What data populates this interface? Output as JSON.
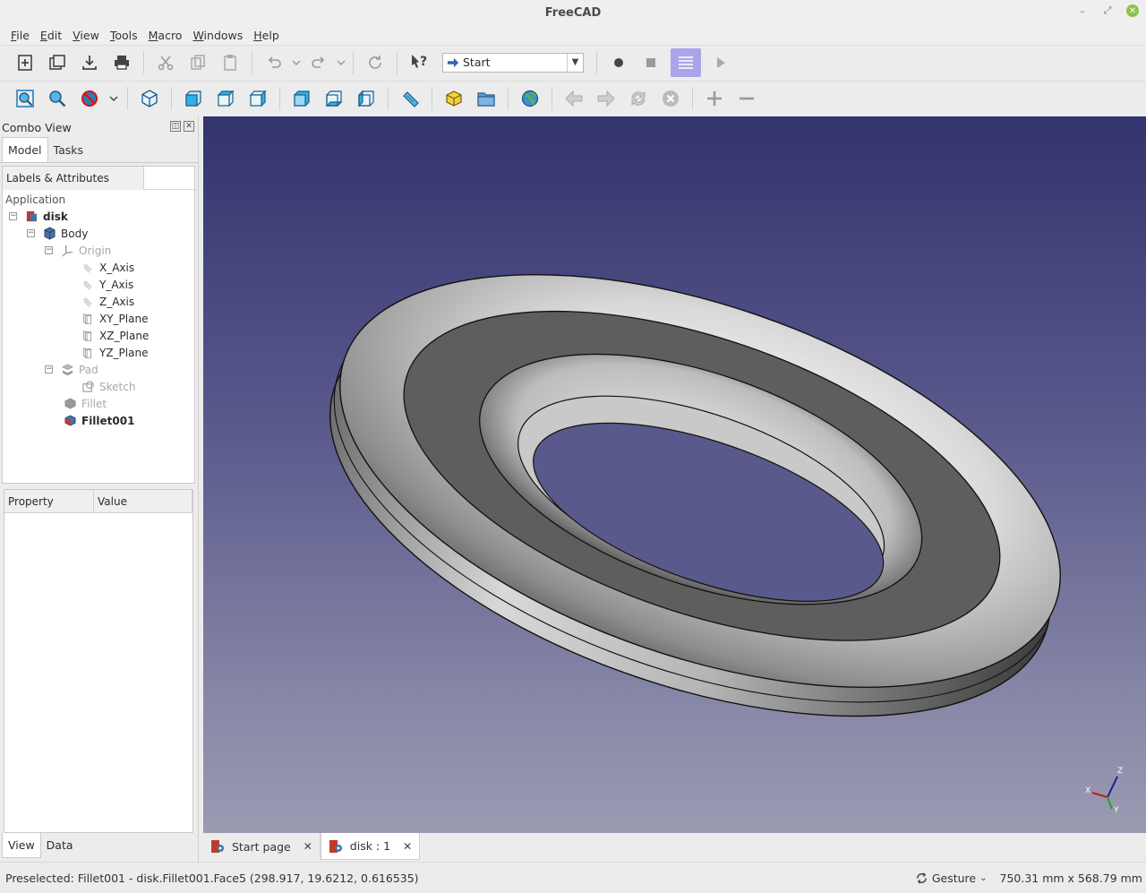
{
  "window": {
    "title": "FreeCAD"
  },
  "menu": [
    "File",
    "Edit",
    "View",
    "Tools",
    "Macro",
    "Windows",
    "Help"
  ],
  "toolbar": {
    "workbench": "Start"
  },
  "combo_view": {
    "title": "Combo View",
    "tabs": [
      "Model",
      "Tasks"
    ],
    "tree_header": "Labels & Attributes",
    "application_label": "Application",
    "tree": [
      {
        "label": "disk",
        "depth": 0,
        "style": "bold",
        "icon": "document-icon",
        "expander": "−"
      },
      {
        "label": "Body",
        "depth": 1,
        "style": "normal",
        "icon": "body-icon",
        "expander": "−"
      },
      {
        "label": "Origin",
        "depth": 2,
        "style": "grey",
        "icon": "origin-icon",
        "expander": "−"
      },
      {
        "label": "X_Axis",
        "depth": 3,
        "style": "normal",
        "icon": "axis-icon",
        "expander": ""
      },
      {
        "label": "Y_Axis",
        "depth": 3,
        "style": "normal",
        "icon": "axis-icon",
        "expander": ""
      },
      {
        "label": "Z_Axis",
        "depth": 3,
        "style": "normal",
        "icon": "axis-icon",
        "expander": ""
      },
      {
        "label": "XY_Plane",
        "depth": 3,
        "style": "normal",
        "icon": "plane-icon",
        "expander": ""
      },
      {
        "label": "XZ_Plane",
        "depth": 3,
        "style": "normal",
        "icon": "plane-icon",
        "expander": ""
      },
      {
        "label": "YZ_Plane",
        "depth": 3,
        "style": "normal",
        "icon": "plane-icon",
        "expander": ""
      },
      {
        "label": "Pad",
        "depth": 2,
        "style": "grey",
        "icon": "pad-icon",
        "expander": "−"
      },
      {
        "label": "Sketch",
        "depth": 3,
        "style": "grey",
        "icon": "sketch-icon",
        "expander": ""
      },
      {
        "label": "Fillet",
        "depth": 2,
        "style": "grey",
        "icon": "fillet-icon",
        "expander": ""
      },
      {
        "label": "Fillet001",
        "depth": 2,
        "style": "bold",
        "icon": "fillet-active-icon",
        "expander": ""
      }
    ],
    "property_headers": [
      "Property",
      "Value"
    ],
    "bottom_tabs": [
      "View",
      "Data"
    ]
  },
  "doc_tabs": [
    {
      "label": "Start page",
      "active": false
    },
    {
      "label": "disk : 1",
      "active": true
    }
  ],
  "status": {
    "message": "Preselected: Fillet001 - disk.Fillet001.Face5 (298.917, 19.6212, 0.616535)",
    "navigation": "Gesture",
    "dimensions": "750.31 mm x 568.79 mm"
  },
  "axis_labels": {
    "x": "X",
    "y": "Y",
    "z": "Z"
  },
  "colors": {
    "active_button": "#a9a6e8",
    "view_top": "#33336e",
    "view_bottom": "#9a9ab2",
    "close_button": "#8bc34a"
  }
}
